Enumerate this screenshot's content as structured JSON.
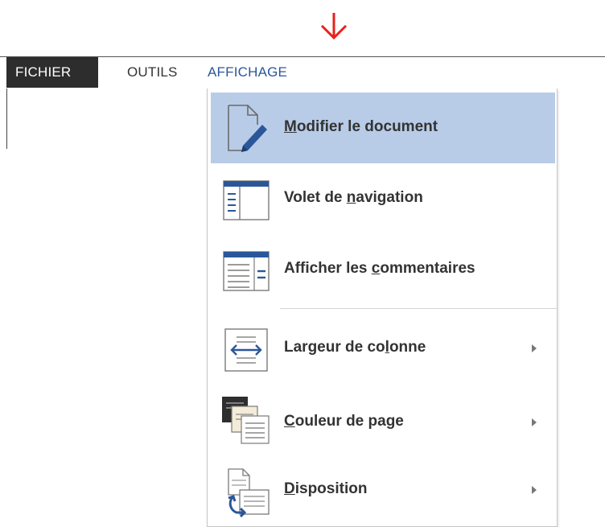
{
  "colors": {
    "accent": "#2b579a",
    "file_tab_bg": "#2d2d2d",
    "highlight": "#b8cce8",
    "annotation_arrow": "#e8201a"
  },
  "ribbon": {
    "tabs": [
      {
        "label": "FICHIER",
        "selected": false
      },
      {
        "label": "OUTILS",
        "selected": false
      },
      {
        "label": "AFFICHAGE",
        "selected": true
      }
    ]
  },
  "menu": {
    "items": [
      {
        "pre": "",
        "u": "M",
        "post": "odifier le document",
        "icon": "edit-document-icon",
        "highlighted": true,
        "submenu": false
      },
      {
        "pre": "Volet de ",
        "u": "n",
        "post": "avigation",
        "icon": "navigation-pane-icon",
        "highlighted": false,
        "submenu": false
      },
      {
        "pre": "Afficher les ",
        "u": "c",
        "post": "ommentaires",
        "icon": "show-comments-icon",
        "highlighted": false,
        "submenu": false
      },
      {
        "pre": "Largeur de co",
        "u": "l",
        "post": "onne",
        "icon": "column-width-icon",
        "highlighted": false,
        "submenu": true
      },
      {
        "pre": "",
        "u": "C",
        "post": "ouleur de page",
        "icon": "page-color-icon",
        "highlighted": false,
        "submenu": true
      },
      {
        "pre": "",
        "u": "D",
        "post": "isposition",
        "icon": "layout-icon",
        "highlighted": false,
        "submenu": true
      }
    ]
  }
}
